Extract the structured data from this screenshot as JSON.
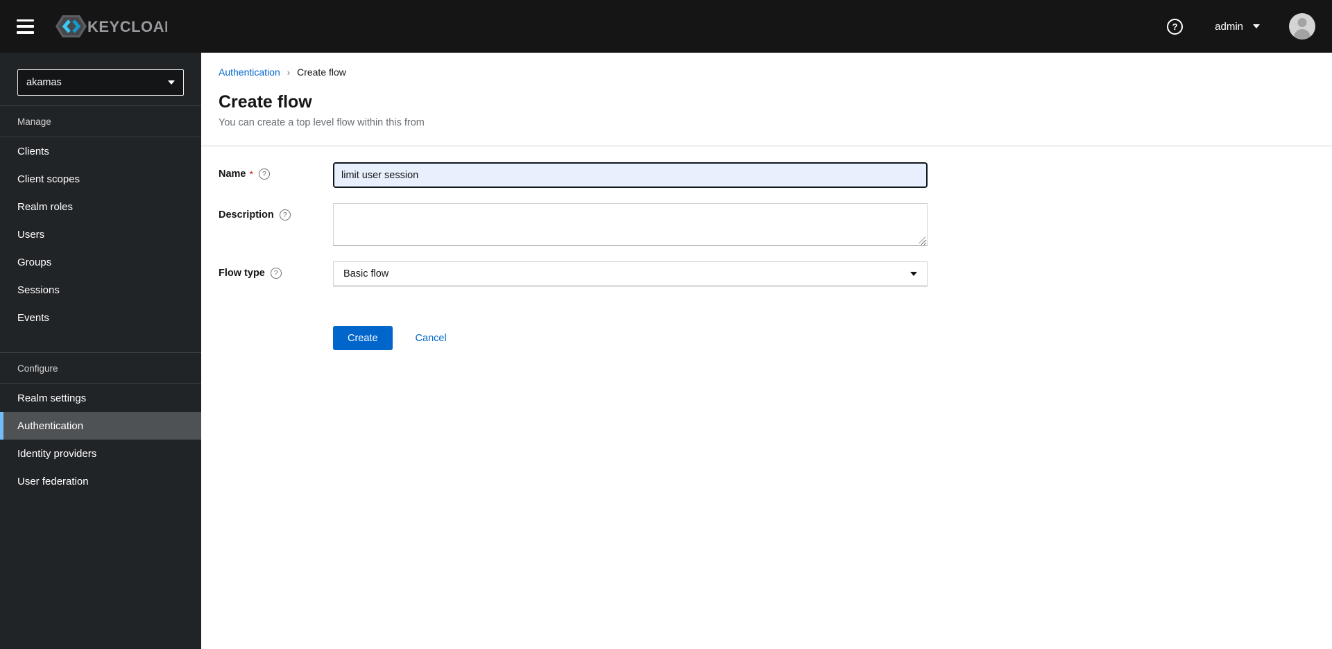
{
  "masthead": {
    "brand": "KEYCLOAK",
    "user_label": "admin",
    "help_glyph": "?"
  },
  "sidebar": {
    "realm": "akamas",
    "sections": [
      {
        "label": "Manage",
        "items": [
          "Clients",
          "Client scopes",
          "Realm roles",
          "Users",
          "Groups",
          "Sessions",
          "Events"
        ]
      },
      {
        "label": "Configure",
        "items": [
          "Realm settings",
          "Authentication",
          "Identity providers",
          "User federation"
        ],
        "selected": "Authentication"
      }
    ]
  },
  "breadcrumb": {
    "parent": "Authentication",
    "separator": "›",
    "current": "Create flow"
  },
  "page": {
    "title": "Create flow",
    "subtitle": "You can create a top level flow within this from"
  },
  "form": {
    "help_glyph": "?",
    "name_label": "Name",
    "name_required": "*",
    "name_value": "limit user session",
    "description_label": "Description",
    "description_value": "",
    "flow_type_label": "Flow type",
    "flow_type_value": "Basic flow",
    "create_label": "Create",
    "cancel_label": "Cancel"
  },
  "colors": {
    "accent": "#0066cc",
    "link": "#0066cc",
    "masthead_bg": "#151515",
    "sidebar_bg": "#212427",
    "selected_item_bg": "#4f5255",
    "selected_item_border": "#73bcf7",
    "required": "#c9190b",
    "focused_input_bg": "#e8f0fe",
    "divider": "#d2d2d2",
    "logo_blue_light": "#3bc8f3",
    "logo_blue_dark": "#1598cb"
  }
}
